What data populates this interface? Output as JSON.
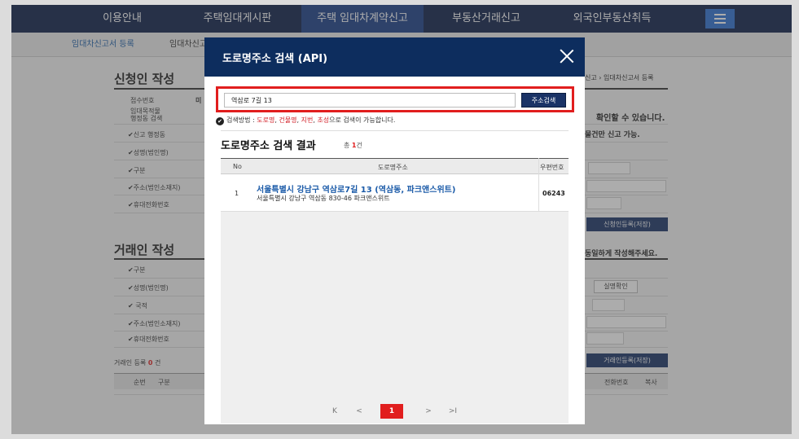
{
  "topnav": {
    "items": [
      "이용안내",
      "주택임대게시판",
      "주택 임대차계약신고",
      "부동산거래신고",
      "외국인부동산취득"
    ]
  },
  "subnav": {
    "items": [
      "임대차신고서 등록",
      "임대차신고"
    ]
  },
  "applicant": {
    "title": "신청인 작성",
    "labels": [
      "접수번호",
      "임대목적물\n행정동 검색",
      "✔신고 행정동",
      "✔성명(법인명)",
      "✔구분",
      "✔주소(법인소재지)",
      "✔휴대전화번호"
    ],
    "receipt_prefix": "미",
    "right_breadcrumb": "신고 › 임대차신고서 등록",
    "notice1": "확인할 수 있습니다.",
    "notice2": "물건만 신고 가능.",
    "save_button": "신청인등록(저장)"
  },
  "counterparty": {
    "title": "거래인 작성",
    "labels": [
      "✔구분",
      "✔성명(법인명)",
      "✔ 국적",
      "✔주소(법인소재지)",
      "✔휴대전화번호"
    ],
    "notice": "동일하게 작성해주세요.",
    "verify_button": "실명확인",
    "save_button": "거래인등록(저장)",
    "count_label": "거래인 등록",
    "count_value": "0",
    "count_unit": "건",
    "table_headers": [
      "순번",
      "구분",
      "전화번호",
      "복사"
    ]
  },
  "modal": {
    "title": "도로명주소 검색 (API)",
    "search_value": "역삼로 7길 13",
    "search_button": "주소검색",
    "hint_prefix": "검색방법 : ",
    "hint_terms": [
      "도로명",
      "건물명",
      "지번",
      "초성"
    ],
    "hint_seps": [
      ", ",
      ", ",
      ", "
    ],
    "hint_suffix": "으로 검색이 가능합니다.",
    "result_title": "도로명주소 검색 결과",
    "result_count_prefix": "총",
    "result_count": "1",
    "result_count_unit": "건",
    "columns": [
      "No",
      "도로명주소",
      "우편번호"
    ],
    "rows": [
      {
        "no": "1",
        "road_address": "서울특별시 강남구 역삼로7길 13 (역삼동, 파크앤스위트)",
        "jibun_address": "서울특별시 강남구 역삼동 830-46 파크앤스위트",
        "zip": "06243"
      }
    ],
    "pager": {
      "first": "K",
      "prev": "<",
      "current": "1",
      "next": ">",
      "last": ">I"
    }
  },
  "colors": {
    "nav": "#0d1f4a",
    "nav_active": "#1a3f88",
    "accent_red": "#e11e1e",
    "modal_head": "#0d2d5e",
    "link_blue": "#1a5aa8"
  }
}
